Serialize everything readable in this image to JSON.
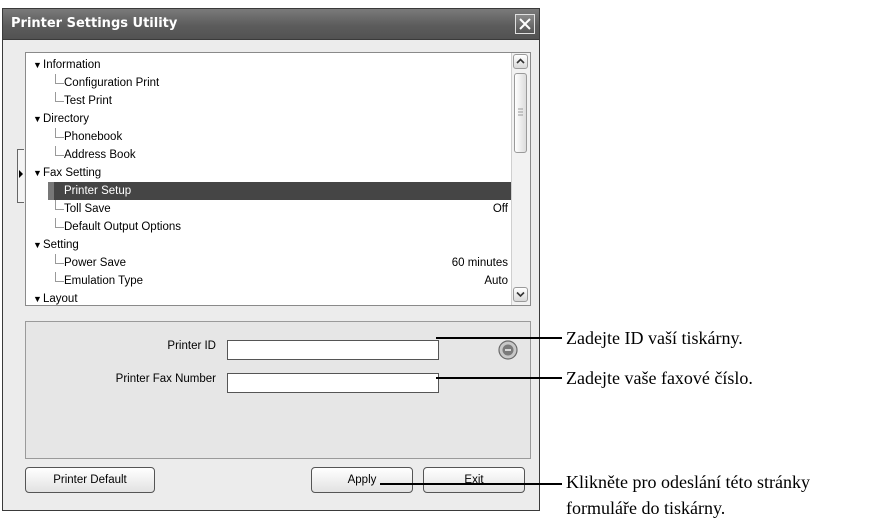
{
  "window": {
    "title": "Printer Settings Utility"
  },
  "tree": {
    "groups": [
      {
        "label": "Information",
        "items": [
          {
            "label": "Configuration Print",
            "value": ""
          },
          {
            "label": "Test Print",
            "value": ""
          }
        ]
      },
      {
        "label": "Directory",
        "items": [
          {
            "label": "Phonebook",
            "value": ""
          },
          {
            "label": "Address Book",
            "value": ""
          }
        ]
      },
      {
        "label": "Fax Setting",
        "items": [
          {
            "label": "Printer Setup",
            "value": "",
            "selected": true
          },
          {
            "label": "Toll Save",
            "value": "Off"
          },
          {
            "label": "Default Output Options",
            "value": ""
          }
        ]
      },
      {
        "label": "Setting",
        "items": [
          {
            "label": "Power Save",
            "value": "60 minutes"
          },
          {
            "label": "Emulation Type",
            "value": "Auto"
          }
        ]
      },
      {
        "label": "Layout",
        "items": []
      }
    ]
  },
  "form": {
    "printer_id_label": "Printer ID",
    "printer_id_value": "",
    "fax_number_label": "Printer Fax Number",
    "fax_number_value": ""
  },
  "buttons": {
    "printer_default": "Printer Default",
    "apply": "Apply",
    "exit": "Exit"
  },
  "annotations": {
    "printer_id": "Zadejte ID vaší tiskárny.",
    "fax_number": "Zadejte vaše faxové číslo.",
    "apply_line1": "Klikněte pro odeslání této stránky",
    "apply_line2": "formuláře do tiskárny."
  }
}
